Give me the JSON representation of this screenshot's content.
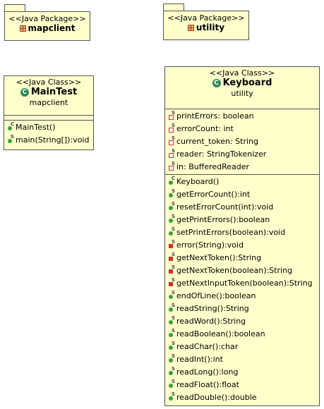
{
  "packages": [
    {
      "stereotype": "<<Java Package>>",
      "name": "mapclient"
    },
    {
      "stereotype": "<<Java Package>>",
      "name": "utility"
    }
  ],
  "main_test": {
    "stereotype": "<<Java Class>>",
    "name": "MainTest",
    "package": "mapclient",
    "methods": [
      "MainTest()",
      "main(String[]):void"
    ]
  },
  "keyboard": {
    "stereotype": "<<Java Class>>",
    "name": "Keyboard",
    "package": "utility",
    "fields": [
      "printErrors: boolean",
      "errorCount: int",
      "current_token: String",
      "reader: StringTokenizer",
      "in: BufferedReader"
    ],
    "methods": [
      "Keyboard()",
      "getErrorCount():int",
      "resetErrorCount(int):void",
      "getPrintErrors():boolean",
      "setPrintErrors(boolean):void",
      "error(String):void",
      "getNextToken():String",
      "getNextToken(boolean):String",
      "getNextInputToken(boolean):String",
      "endOfLine():boolean",
      "readString():String",
      "readWord():String",
      "readBoolean():boolean",
      "readChar():char",
      "readInt():int",
      "readLong():long",
      "readFloat():float",
      "readDouble():double"
    ]
  },
  "colors": {
    "fill": "#ffffcc",
    "border": "#555555",
    "public": "#3aa03a",
    "private": "#d03030",
    "class_icon": "#2e8b57"
  }
}
